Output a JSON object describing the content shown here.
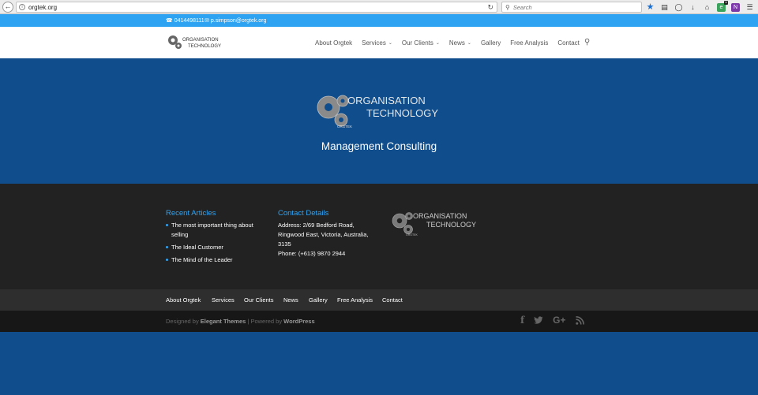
{
  "browser": {
    "url": "orgtek.org",
    "search_placeholder": "Search"
  },
  "top_bar": {
    "phone": "0414498111",
    "email": "p.simpson@orgtek.org"
  },
  "logo": {
    "line1": "ORGANISATION",
    "line2": "TECHNOLOGY",
    "mark": "ORGTEK"
  },
  "nav": {
    "items": [
      {
        "label": "About Orgtek",
        "dropdown": false
      },
      {
        "label": "Services",
        "dropdown": true
      },
      {
        "label": "Our Clients",
        "dropdown": true
      },
      {
        "label": "News",
        "dropdown": true
      },
      {
        "label": "Gallery",
        "dropdown": false
      },
      {
        "label": "Free Analysis",
        "dropdown": false
      },
      {
        "label": "Contact",
        "dropdown": false
      }
    ]
  },
  "hero": {
    "tagline": "Management Consulting"
  },
  "footer": {
    "recent_title": "Recent Articles",
    "articles": [
      "The most important thing about selling",
      "The Ideal Customer",
      "The Mind of the Leader"
    ],
    "contact_title": "Contact Details",
    "address": "Address: 2/69 Bedford Road, Ringwood East, Victoria, Australia, 3135",
    "phone": "Phone: (+613) 9870 2944"
  },
  "bottom_nav": [
    "About Orgtek",
    "Services",
    "Our Clients",
    "News",
    "Gallery",
    "Free Analysis",
    "Contact"
  ],
  "credits": {
    "designed_by": "Designed by",
    "elegant": "Elegant Themes",
    "sep": "|",
    "powered_by": "Powered by",
    "wordpress": "WordPress"
  },
  "social": {
    "facebook": "f",
    "twitter": "t",
    "google": "G+",
    "rss": "rss"
  },
  "colors": {
    "accent": "#2ea3f2",
    "hero_bg": "#0f4d8c",
    "footer_bg": "#222222"
  }
}
